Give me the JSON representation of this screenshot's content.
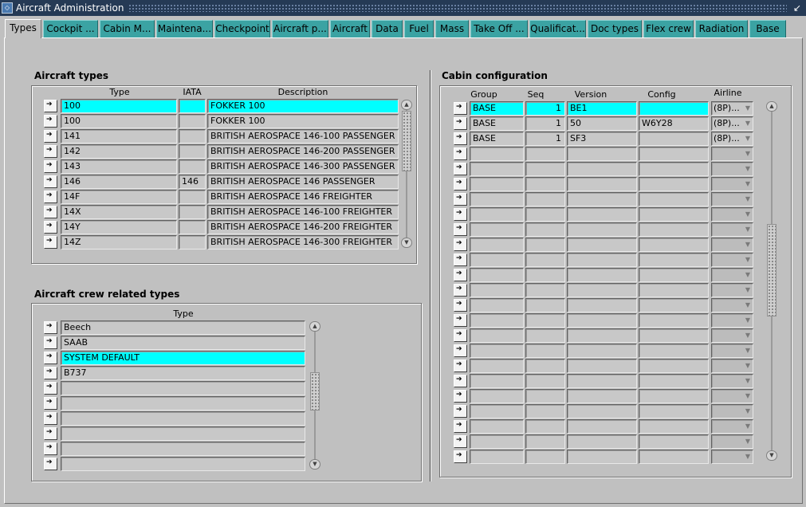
{
  "window": {
    "title": "Aircraft Administration",
    "app_icon": "oracle-forms-icon"
  },
  "tabs": [
    "Types",
    "Cockpit ...",
    "Cabin M...",
    "Maintena...",
    "Checkpoint",
    "Aircraft p...",
    "Aircraft",
    "Data",
    "Fuel",
    "Mass",
    "Take Off ...",
    "Qualificat...",
    "Doc types",
    "Flex crew",
    "Radiation",
    "Base"
  ],
  "aircraft_types": {
    "title": "Aircraft types",
    "headers": {
      "type": "Type",
      "iata": "IATA",
      "description": "Description"
    },
    "rows": [
      {
        "type": "100",
        "iata": "",
        "description": "FOKKER 100"
      },
      {
        "type": "100",
        "iata": "",
        "description": "FOKKER 100"
      },
      {
        "type": "141",
        "iata": "",
        "description": "BRITISH AEROSPACE 146-100 PASSENGER"
      },
      {
        "type": "142",
        "iata": "",
        "description": "BRITISH AEROSPACE 146-200 PASSENGER"
      },
      {
        "type": "143",
        "iata": "",
        "description": "BRITISH AEROSPACE 146-300 PASSENGER"
      },
      {
        "type": "146",
        "iata": "146",
        "description": "BRITISH AEROSPACE 146 PASSENGER"
      },
      {
        "type": "14F",
        "iata": "",
        "description": "BRITISH AEROSPACE 146 FREIGHTER"
      },
      {
        "type": "14X",
        "iata": "",
        "description": "BRITISH AEROSPACE 146-100 FREIGHTER"
      },
      {
        "type": "14Y",
        "iata": "",
        "description": "BRITISH AEROSPACE 146-200 FREIGHTER"
      },
      {
        "type": "14Z",
        "iata": "",
        "description": "BRITISH AEROSPACE 146-300 FREIGHTER"
      }
    ]
  },
  "crew_types": {
    "title": "Aircraft crew related types",
    "headers": {
      "type": "Type"
    },
    "rows": [
      "Beech",
      "SAAB",
      "SYSTEM DEFAULT",
      "B737",
      "",
      "",
      "",
      "",
      "",
      ""
    ]
  },
  "cabin_config": {
    "title": "Cabin configuration",
    "headers": {
      "group": "Group",
      "seq": "Seq",
      "version": "Version",
      "config": "Config",
      "airline": "Airline"
    },
    "rows": [
      {
        "group": "BASE",
        "seq": "1",
        "version": "BE1",
        "config": "",
        "airline": "(8P)..."
      },
      {
        "group": "BASE",
        "seq": "1",
        "version": "50",
        "config": "W6Y28",
        "airline": "(8P)..."
      },
      {
        "group": "BASE",
        "seq": "1",
        "version": "SF3",
        "config": "",
        "airline": "(8P)..."
      },
      {
        "group": "",
        "seq": "",
        "version": "",
        "config": "",
        "airline": ""
      },
      {
        "group": "",
        "seq": "",
        "version": "",
        "config": "",
        "airline": ""
      },
      {
        "group": "",
        "seq": "",
        "version": "",
        "config": "",
        "airline": ""
      },
      {
        "group": "",
        "seq": "",
        "version": "",
        "config": "",
        "airline": ""
      },
      {
        "group": "",
        "seq": "",
        "version": "",
        "config": "",
        "airline": ""
      },
      {
        "group": "",
        "seq": "",
        "version": "",
        "config": "",
        "airline": ""
      },
      {
        "group": "",
        "seq": "",
        "version": "",
        "config": "",
        "airline": ""
      },
      {
        "group": "",
        "seq": "",
        "version": "",
        "config": "",
        "airline": ""
      },
      {
        "group": "",
        "seq": "",
        "version": "",
        "config": "",
        "airline": ""
      },
      {
        "group": "",
        "seq": "",
        "version": "",
        "config": "",
        "airline": ""
      },
      {
        "group": "",
        "seq": "",
        "version": "",
        "config": "",
        "airline": ""
      },
      {
        "group": "",
        "seq": "",
        "version": "",
        "config": "",
        "airline": ""
      },
      {
        "group": "",
        "seq": "",
        "version": "",
        "config": "",
        "airline": ""
      },
      {
        "group": "",
        "seq": "",
        "version": "",
        "config": "",
        "airline": ""
      },
      {
        "group": "",
        "seq": "",
        "version": "",
        "config": "",
        "airline": ""
      },
      {
        "group": "",
        "seq": "",
        "version": "",
        "config": "",
        "airline": ""
      },
      {
        "group": "",
        "seq": "",
        "version": "",
        "config": "",
        "airline": ""
      },
      {
        "group": "",
        "seq": "",
        "version": "",
        "config": "",
        "airline": ""
      },
      {
        "group": "",
        "seq": "",
        "version": "",
        "config": "",
        "airline": ""
      },
      {
        "group": "",
        "seq": "",
        "version": "",
        "config": "",
        "airline": ""
      },
      {
        "group": "",
        "seq": "",
        "version": "",
        "config": "",
        "airline": ""
      }
    ]
  },
  "colors": {
    "title_bar": "#253a55",
    "tab": "#3ba3a3",
    "highlight": "#00ffff",
    "background": "#c0c0c0"
  }
}
